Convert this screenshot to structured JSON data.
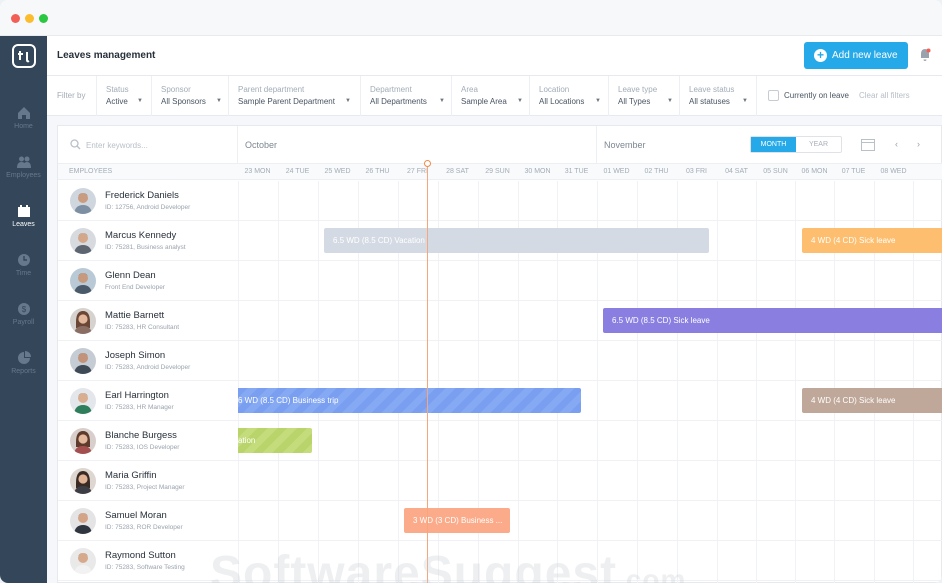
{
  "header": {
    "title": "Leaves management",
    "add_button": "Add new leave"
  },
  "sidebar": {
    "items": [
      {
        "label": "Home",
        "icon": "home-icon"
      },
      {
        "label": "Employees",
        "icon": "employees-icon"
      },
      {
        "label": "Leaves",
        "icon": "leaves-icon",
        "active": true
      },
      {
        "label": "Time",
        "icon": "clock-icon"
      },
      {
        "label": "Payroll",
        "icon": "payroll-icon"
      },
      {
        "label": "Reports",
        "icon": "reports-icon"
      }
    ]
  },
  "filters": {
    "filter_by": "Filter by",
    "items": [
      {
        "label": "Status",
        "value": "Active"
      },
      {
        "label": "Sponsor",
        "value": "All Sponsors"
      },
      {
        "label": "Parent department",
        "value": "Sample Parent Department"
      },
      {
        "label": "Department",
        "value": "All Departments"
      },
      {
        "label": "Area",
        "value": "Sample Area"
      },
      {
        "label": "Location",
        "value": "All Locations"
      },
      {
        "label": "Leave type",
        "value": "All Types"
      },
      {
        "label": "Leave status",
        "value": "All statuses"
      }
    ],
    "current_month": "Currently on leave",
    "clear_all": "Clear all filters"
  },
  "calendar": {
    "search_placeholder": "Enter keywords...",
    "months": [
      "October",
      "November"
    ],
    "view_month": "MONTH",
    "view_year": "YEAR",
    "employees_header": "EMPLOYEES",
    "days": [
      "23 MON",
      "24 TUE",
      "25 WED",
      "26 THU",
      "27 FRI",
      "28 SAT",
      "29 SUN",
      "30 MON",
      "31 TUE",
      "01 WED",
      "02 THU",
      "03 FRI",
      "04 SAT",
      "05 SUN",
      "06 MON",
      "07 TUE",
      "08 WED"
    ],
    "prev": "‹",
    "next": "›"
  },
  "employees": [
    {
      "name": "Frederick Daniels",
      "meta": "ID: 12756, Android Developer"
    },
    {
      "name": "Marcus Kennedy",
      "meta": "ID: 75281, Business analyst"
    },
    {
      "name": "Glenn Dean",
      "meta": "Front End Developer"
    },
    {
      "name": "Mattie Barnett",
      "meta": "ID: 75283, HR Consultant"
    },
    {
      "name": "Joseph Simon",
      "meta": "ID: 75283, Android Developer"
    },
    {
      "name": "Earl Harrington",
      "meta": "ID: 75283, HR Manager"
    },
    {
      "name": "Blanche Burgess",
      "meta": "ID: 75283, IOS Developer"
    },
    {
      "name": "Maria Griffin",
      "meta": "ID: 75283, Project Manager"
    },
    {
      "name": "Samuel Moran",
      "meta": "ID: 75283, ROR Developer"
    },
    {
      "name": "Raymond Sutton",
      "meta": "ID: 75283, Software Testing"
    }
  ],
  "leaves": {
    "marcus_vacation": "6.5 WD (8.5 CD) Vacation",
    "marcus_sick": "4 WD (4 CD) Sick leave",
    "mattie_sick": "6.5 WD (8.5 CD) Sick leave",
    "earl_trip": "6 WD (8.5 CD) Business trip",
    "earl_sick": "4 WD (4 CD) Sick leave",
    "blanche_vacation": "ation",
    "samuel_trip": "3 WD (3 CD) Business ..."
  },
  "colors": {
    "accent": "#26a9e8",
    "vacation": "#d4dae3",
    "sick_orange": "#fdbf6f",
    "sick_purple": "#8a7fe0",
    "business_trip": "#7a9ff0",
    "sick_brown": "#bfa89a",
    "vacation_green": "#b9d46a",
    "business_orange": "#fbab8a",
    "today": "#f08a4b"
  },
  "watermark": {
    "main": "SoftwareSuggest",
    "suffix": ".com"
  }
}
